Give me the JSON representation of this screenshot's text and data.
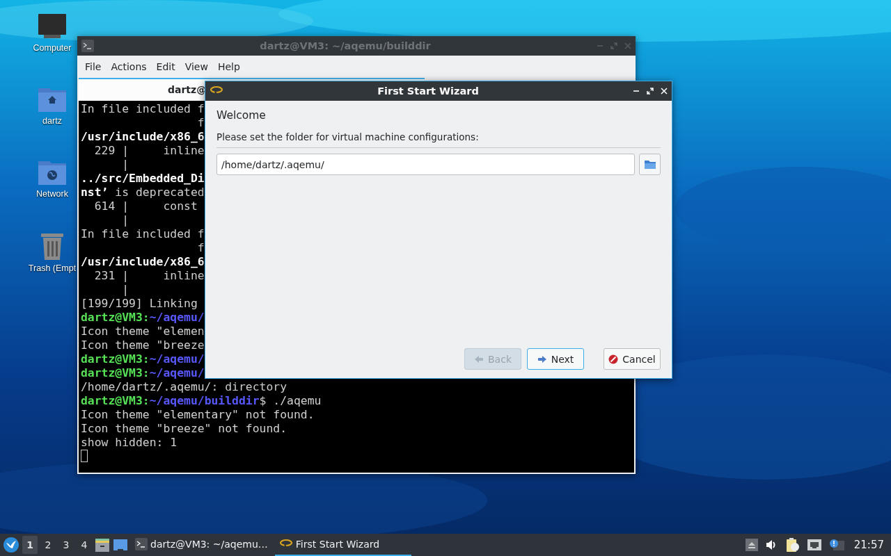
{
  "desktop_icons": [
    {
      "label": "Computer",
      "kind": "computer"
    },
    {
      "label": "dartz",
      "kind": "home"
    },
    {
      "label": "Network",
      "kind": "network"
    },
    {
      "label": "Trash (Empt",
      "kind": "trash"
    }
  ],
  "terminal": {
    "title": "dartz@VM3: ~/aqemu/builddir",
    "menu": [
      "File",
      "Actions",
      "Edit",
      "View",
      "Help"
    ],
    "tab": "dartz@",
    "lines": [
      {
        "kind": "plain",
        "text": "In file included f"
      },
      {
        "kind": "plain",
        "text": "                 f"
      },
      {
        "kind": "bold",
        "text": "/usr/include/x86_6"
      },
      {
        "kind": "plain",
        "text": "  229 |     inline"
      },
      {
        "kind": "plain",
        "text": "      |"
      },
      {
        "kind": "bold",
        "text": "../src/Embedded_Di"
      },
      {
        "kind": "plain",
        "text": "**nst’** is deprecated"
      },
      {
        "kind": "plain",
        "text": "  614 |     const"
      },
      {
        "kind": "plain",
        "text": "      |"
      },
      {
        "kind": "plain",
        "text": "In file included f"
      },
      {
        "kind": "plain",
        "text": "                 f"
      },
      {
        "kind": "bold",
        "text": "/usr/include/x86_6"
      },
      {
        "kind": "plain",
        "text": "  231 |     inline"
      },
      {
        "kind": "plain",
        "text": "      |"
      },
      {
        "kind": "plain",
        "text": "[199/199] Linking"
      },
      {
        "kind": "prompt",
        "user": "dartz@VM3:",
        "path": "~/aqemu/"
      },
      {
        "kind": "plain",
        "text": "Icon theme \"elemen"
      },
      {
        "kind": "plain",
        "text": "Icon theme \"breeze"
      },
      {
        "kind": "prompt",
        "user": "dartz@VM3:",
        "path": "~/aqemu/"
      },
      {
        "kind": "prompt",
        "user": "dartz@VM3:",
        "path": "~/aqemu/"
      },
      {
        "kind": "plain",
        "text": "/home/dartz/.aqemu/: directory"
      },
      {
        "kind": "prompt",
        "user": "dartz@VM3:",
        "path": "~/aqemu/builddir",
        "command": "$ ./aqemu"
      },
      {
        "kind": "plain",
        "text": "Icon theme \"elementary\" not found."
      },
      {
        "kind": "plain",
        "text": "Icon theme \"breeze\" not found."
      },
      {
        "kind": "plain",
        "text": "show hidden: 1"
      },
      {
        "kind": "cursor"
      }
    ]
  },
  "wizard": {
    "title": "First Start Wizard",
    "heading": "Welcome",
    "prompt": "Please set the folder for virtual machine configurations:",
    "folder": "/home/dartz/.aqemu/",
    "buttons": [
      {
        "label": "Back",
        "kind": "back",
        "disabled": true
      },
      {
        "label": "Next",
        "kind": "next",
        "disabled": false
      },
      {
        "label": "Cancel",
        "kind": "cancel",
        "disabled": false
      }
    ]
  },
  "taskbar": {
    "desktops": [
      {
        "label": "1",
        "selected": true
      },
      {
        "label": "2",
        "selected": false
      },
      {
        "label": "3",
        "selected": false
      },
      {
        "label": "4",
        "selected": false
      }
    ],
    "tasks": [
      {
        "label": "dartz@VM3: ~/aqemu…",
        "kind": "terminal",
        "selected": false
      },
      {
        "label": "First Start Wizard",
        "kind": "wizard",
        "selected": true
      }
    ],
    "clock": "21:57"
  }
}
